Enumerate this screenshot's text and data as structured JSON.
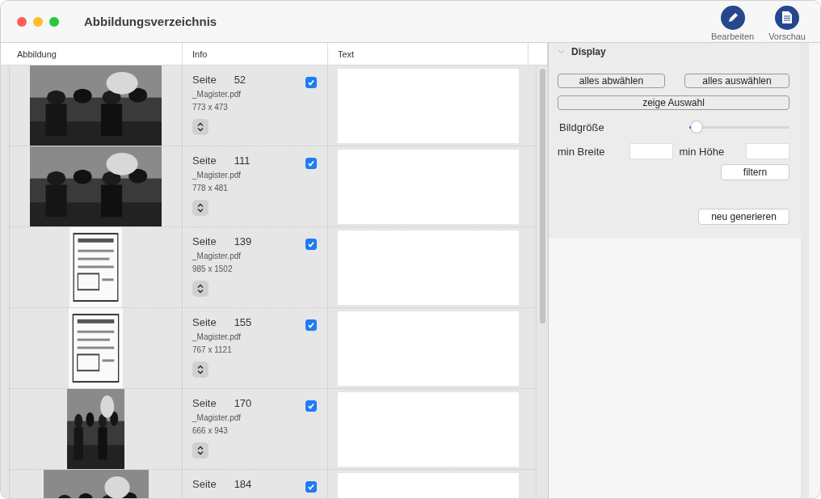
{
  "window": {
    "title": "Abbildungsverzeichnis"
  },
  "toolbar": [
    {
      "label": "Bearbeiten",
      "kind": "edit"
    },
    {
      "label": "Vorschau",
      "kind": "preview"
    }
  ],
  "table": {
    "columns": [
      "Abbildung",
      "Info",
      "Text"
    ],
    "rows": [
      {
        "page_label": "Seite",
        "page": "52",
        "file": "_Magister.pdf",
        "size": "773 x 473",
        "checked": true
      },
      {
        "page_label": "Seite",
        "page": "111",
        "file": "_Magister.pdf",
        "size": "778 x 481",
        "checked": true
      },
      {
        "picture": {
          "kind": "document"
        },
        "page_label": "Seite",
        "page": "139",
        "file": "_Magister.pdf",
        "size": "985 x 1502",
        "checked": true
      },
      {
        "picture": {
          "kind": "document"
        },
        "page_label": "Seite",
        "page": "155",
        "file": "_Magister.pdf",
        "size": "767 x 1121",
        "checked": true
      },
      {
        "page_label": "Seite",
        "page": "170",
        "file": "_Magister.pdf",
        "size": "666 x 943",
        "checked": true
      },
      {
        "page_label": "Seite",
        "page": "184",
        "checked": true
      }
    ]
  },
  "panel": {
    "title": "Display",
    "expanded": true,
    "buttons_top": [
      "alles abwählen",
      "alles auswählen"
    ],
    "show_button": "zeige Auswahl",
    "slider": {
      "label": "Bildgröße",
      "level": 0.07
    },
    "min_width": {
      "label": "min Breite"
    },
    "min_height": {
      "label": "min Höhe"
    },
    "filter_button": "filtern",
    "regenerate_button": "neu generieren"
  }
}
